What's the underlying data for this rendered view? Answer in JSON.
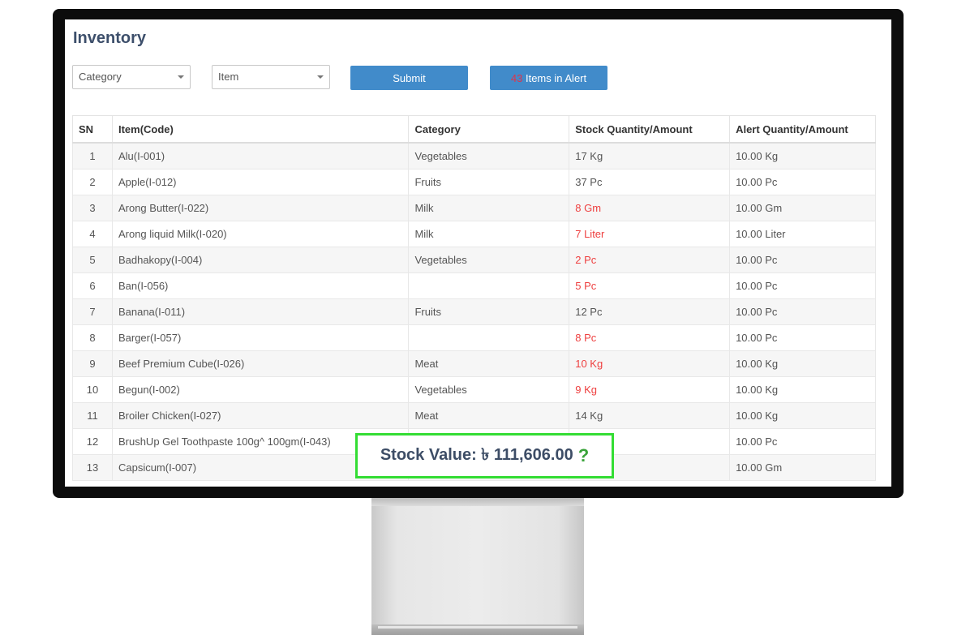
{
  "page": {
    "title": "Inventory"
  },
  "filters": {
    "category_placeholder": "Category",
    "item_placeholder": "Item",
    "submit_label": "Submit",
    "alert_count": "43",
    "alert_label": " Items in Alert"
  },
  "table": {
    "headers": [
      "SN",
      "Item(Code)",
      "Category",
      "Stock Quantity/Amount",
      "Alert Quantity/Amount"
    ],
    "rows": [
      {
        "sn": "1",
        "item": "Alu(I-001)",
        "category": "Vegetables",
        "stock": "17 Kg",
        "alert": "10.00 Kg",
        "low": false
      },
      {
        "sn": "2",
        "item": "Apple(I-012)",
        "category": "Fruits",
        "stock": "37 Pc",
        "alert": "10.00 Pc",
        "low": false
      },
      {
        "sn": "3",
        "item": "Arong Butter(I-022)",
        "category": "Milk",
        "stock": "8 Gm",
        "alert": "10.00 Gm",
        "low": true
      },
      {
        "sn": "4",
        "item": "Arong liquid Milk(I-020)",
        "category": "Milk",
        "stock": "7 Liter",
        "alert": "10.00 Liter",
        "low": true
      },
      {
        "sn": "5",
        "item": "Badhakopy(I-004)",
        "category": "Vegetables",
        "stock": "2 Pc",
        "alert": "10.00 Pc",
        "low": true
      },
      {
        "sn": "6",
        "item": "Ban(I-056)",
        "category": "",
        "stock": "5 Pc",
        "alert": "10.00 Pc",
        "low": true
      },
      {
        "sn": "7",
        "item": "Banana(I-011)",
        "category": "Fruits",
        "stock": "12 Pc",
        "alert": "10.00 Pc",
        "low": false
      },
      {
        "sn": "8",
        "item": "Barger(I-057)",
        "category": "",
        "stock": "8 Pc",
        "alert": "10.00 Pc",
        "low": true
      },
      {
        "sn": "9",
        "item": "Beef Premium Cube(I-026)",
        "category": "Meat",
        "stock": "10 Kg",
        "alert": "10.00 Kg",
        "low": true
      },
      {
        "sn": "10",
        "item": "Begun(I-002)",
        "category": "Vegetables",
        "stock": "9 Kg",
        "alert": "10.00 Kg",
        "low": true
      },
      {
        "sn": "11",
        "item": "Broiler Chicken(I-027)",
        "category": "Meat",
        "stock": "14 Kg",
        "alert": "10.00 Kg",
        "low": false
      },
      {
        "sn": "12",
        "item": "BrushUp Gel Toothpaste 100g^ 100gm(I-043)",
        "category": "",
        "stock": "",
        "alert": "10.00 Pc",
        "low": false
      },
      {
        "sn": "13",
        "item": "Capsicum(I-007)",
        "category": "",
        "stock": "",
        "alert": "10.00 Gm",
        "low": false
      }
    ]
  },
  "stock_value": {
    "label": "Stock Value: ৳ 111,606.00",
    "help": "?"
  },
  "colors": {
    "accent": "#418bca",
    "low_stock": "#ee3f3f",
    "highlight_border": "#33dd33"
  }
}
